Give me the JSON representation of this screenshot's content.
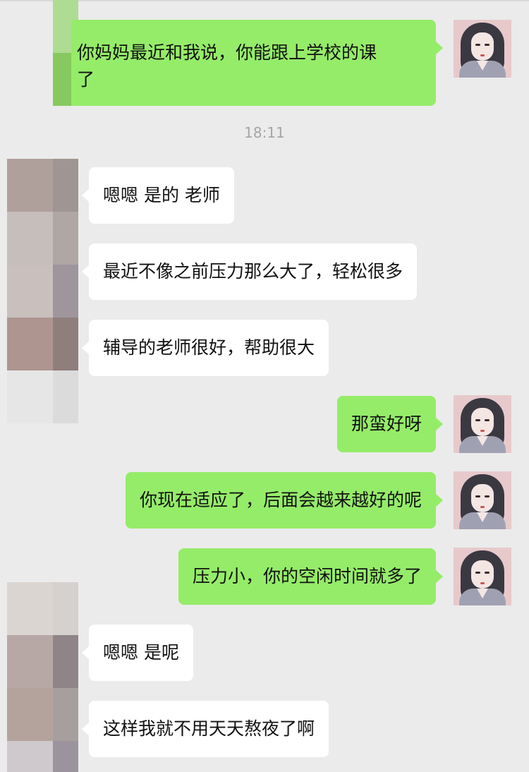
{
  "chat": {
    "timestamp": "18:11",
    "messages": [
      {
        "side": "right",
        "line1": "你妈妈最近和我说，你能跟上学校的课",
        "line2": "了"
      },
      {
        "side": "left",
        "text": "嗯嗯 是的 老师"
      },
      {
        "side": "left",
        "text": "最近不像之前压力那么大了，轻松很多"
      },
      {
        "side": "left",
        "text": "辅导的老师很好，帮助很大"
      },
      {
        "side": "right",
        "text": "那蛮好呀"
      },
      {
        "side": "right",
        "text": "你现在适应了，后面会越来越好的呢"
      },
      {
        "side": "right",
        "text": "压力小，你的空闲时间就多了"
      },
      {
        "side": "left",
        "text": "嗯嗯 是呢"
      },
      {
        "side": "left",
        "text": "这样我就不用天天熬夜了啊"
      }
    ]
  },
  "colors": {
    "background": "#ebebeb",
    "outgoing_bubble": "#95ec69",
    "incoming_bubble": "#ffffff",
    "timestamp": "#a6a6a6"
  },
  "icons": {
    "self_avatar": "avatar-girl-braids",
    "contact_avatar": "pixelated-avatar"
  }
}
